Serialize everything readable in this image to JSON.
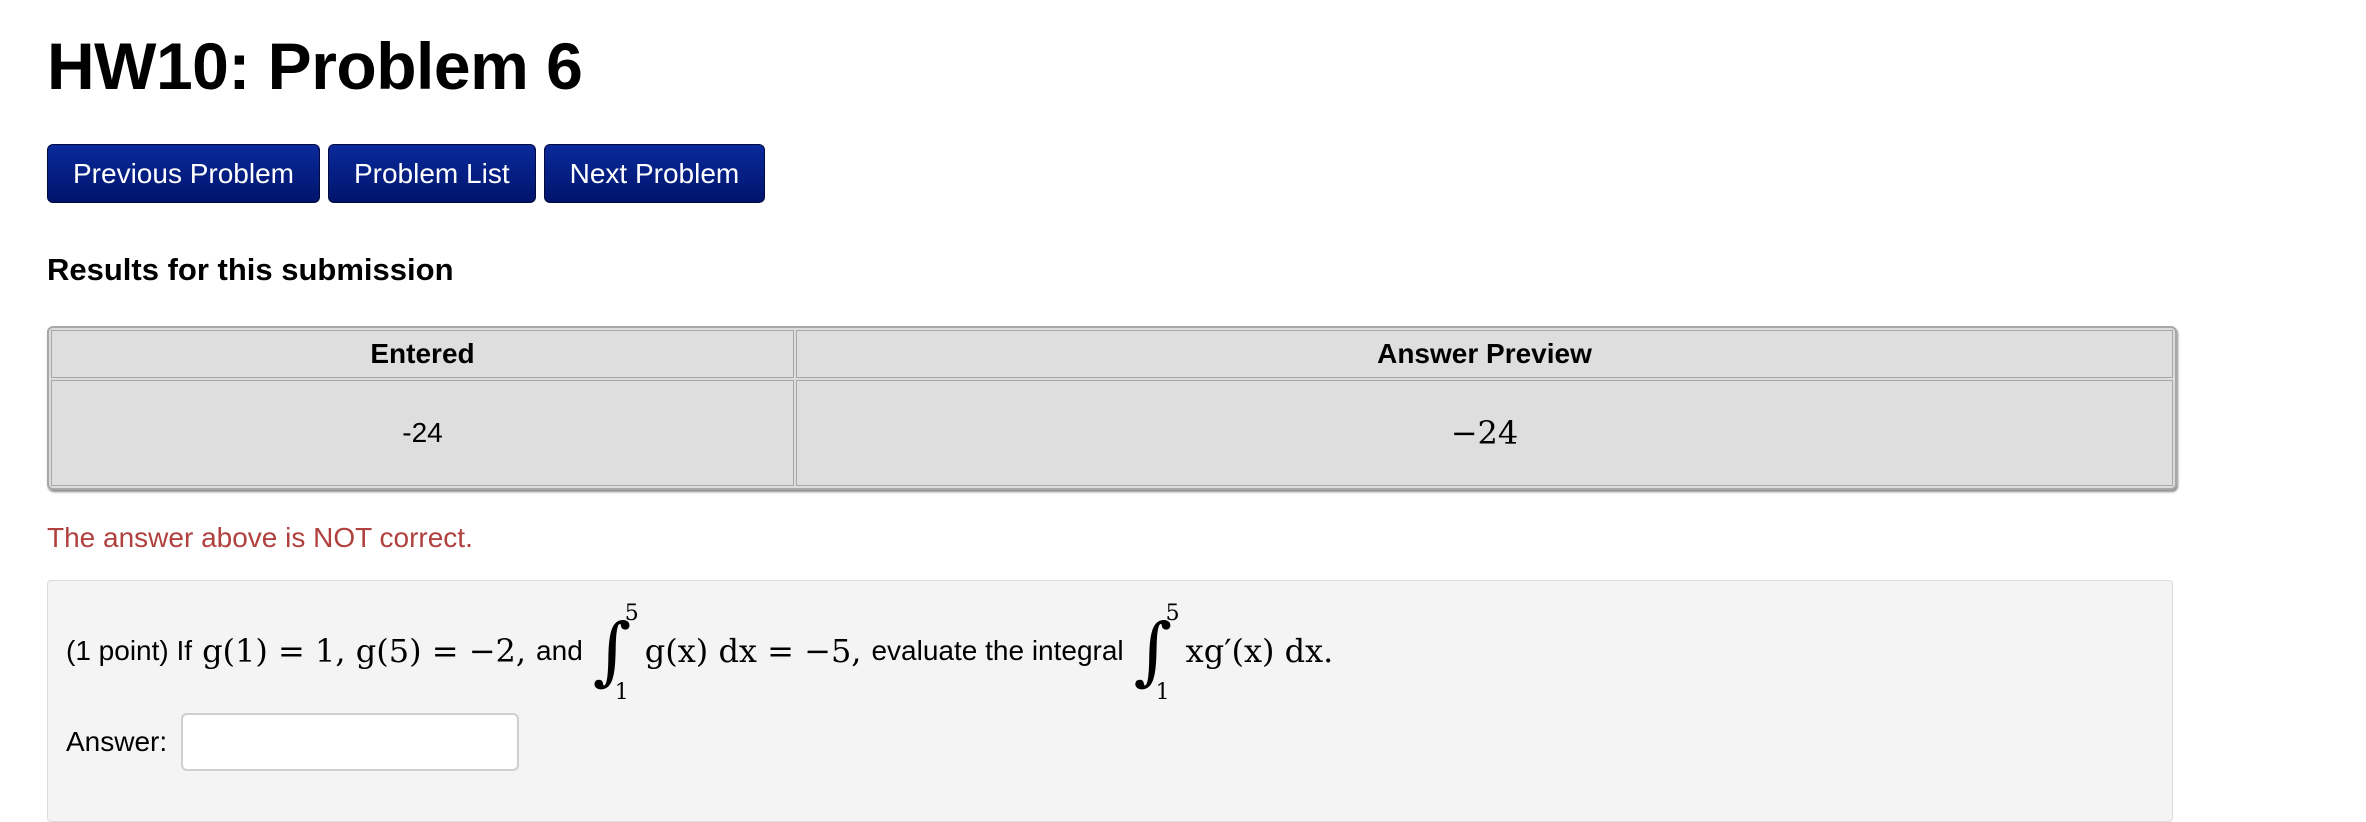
{
  "page": {
    "title": "HW10: Problem 6"
  },
  "nav": {
    "previous_label": "Previous Problem",
    "list_label": "Problem List",
    "next_label": "Next Problem"
  },
  "results": {
    "heading": "Results for this submission",
    "columns": [
      "Entered",
      "Answer Preview"
    ],
    "rows": [
      {
        "entered": "-24",
        "preview": "−24"
      }
    ],
    "feedback": "The answer above is NOT correct.",
    "feedback_color": "#b0413e"
  },
  "problem": {
    "points": "(1 point) If",
    "g1": "g(1) = 1, g(5) = −2,",
    "and_text": "and",
    "integral1_upper": "5",
    "integral1_lower": "1",
    "integrand1": "g(x) dx = −5,",
    "evaluate_text": "evaluate the integral",
    "integral2_upper": "5",
    "integral2_lower": "1",
    "integrand2": "xg′(x) dx.",
    "answer_label": "Answer:",
    "answer_value": "",
    "answer_placeholder": ""
  },
  "colors": {
    "button_bg": "#00146b",
    "button_text": "#ffffff",
    "table_bg": "#dedede",
    "problem_bg": "#f4f4f4"
  }
}
